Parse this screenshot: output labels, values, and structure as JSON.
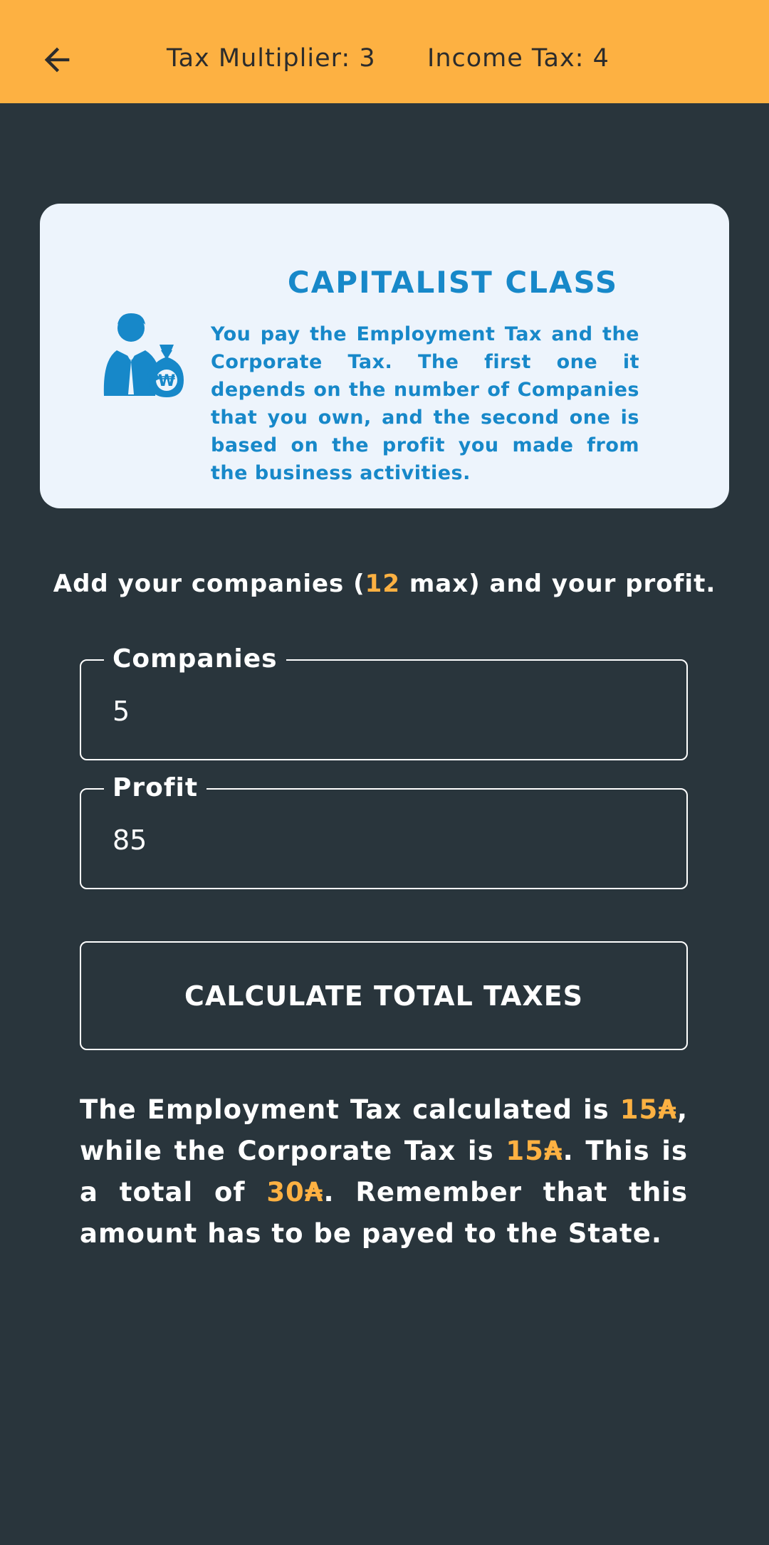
{
  "header": {
    "back_icon": "arrow-left-icon",
    "tax_multiplier": "Tax Multiplier: 3",
    "income_tax": "Income Tax: 4",
    "background_color": "#fdb142"
  },
  "card": {
    "icon": "businessman-money-bag-icon",
    "title": "CAPITALIST CLASS",
    "description": "You pay the Employment Tax and the Corporate Tax. The first one it depends on the number of Companies that you own, and the second one is based on the profit you made from the business activities."
  },
  "instruction": {
    "before": "Add your companies (",
    "max": "12",
    "after": " max) and your profit."
  },
  "form": {
    "companies_label": "Companies",
    "companies_value": "5",
    "profit_label": "Profit",
    "profit_value": "85"
  },
  "calculate_button": "CALCULATE TOTAL TAXES",
  "result": {
    "part1": "The Employment Tax calculated is ",
    "employment_tax": "15₳",
    "part2": ", while the Corporate Tax is ",
    "corporate_tax": "15₳",
    "part3": ". This is a total of ",
    "total": "30₳",
    "part4": ". Remember that this amount has to be payed to the State."
  },
  "colors": {
    "background": "#29353c",
    "accent": "#fdb142",
    "card_background": "#edf4fc",
    "card_text": "#1788c9"
  }
}
